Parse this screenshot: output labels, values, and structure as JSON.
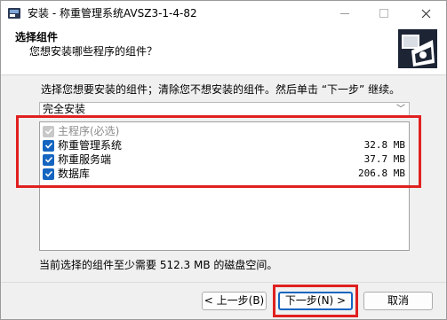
{
  "window": {
    "title": "安装 - 称重管理系统AVSZ3-1-4-82"
  },
  "header": {
    "title": "选择组件",
    "subtitle": "您想安装哪些程序的组件？"
  },
  "main": {
    "instruction": "选择您想要安装的组件；清除您不想安装的组件。然后单击 “下一步” 继续。",
    "install_type": "完全安装",
    "components": [
      {
        "label": "主程序(必选)",
        "size": "",
        "checked": true,
        "disabled": true
      },
      {
        "label": "称重管理系统",
        "size": "32.8 MB",
        "checked": true,
        "disabled": false
      },
      {
        "label": "称重服务端",
        "size": "37.7 MB",
        "checked": true,
        "disabled": false
      },
      {
        "label": "数据库",
        "size": "206.8 MB",
        "checked": true,
        "disabled": false
      }
    ],
    "space_info": "当前选择的组件至少需要 512.3 MB 的磁盘空间。"
  },
  "buttons": {
    "back": "< 上一步(B)",
    "next": "下一步(N) >",
    "cancel": "取消"
  },
  "colors": {
    "accent": "#1565c0",
    "annotation": "#e02020"
  }
}
